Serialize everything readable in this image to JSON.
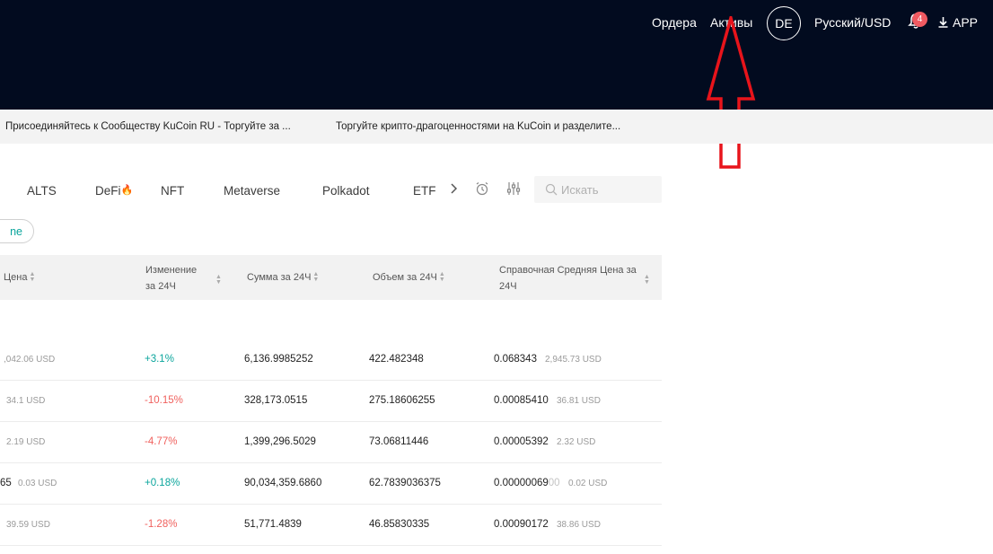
{
  "header": {
    "orders": "Ордера",
    "assets": "Активы",
    "avatar": "DE",
    "language": "Русский/USD",
    "notifications": "4",
    "app": "APP"
  },
  "ticker": [
    "Присоединяйтесь к Сообществу KuCoin RU - Торгуйте за ...",
    "Торгуйте крипто-драгоценностями на KuCoin и разделите..."
  ],
  "tabs": [
    "ALTS",
    "DeFi",
    "NFT",
    "Metaverse",
    "Polkadot",
    "ETF"
  ],
  "search": {
    "placeholder": "Искать"
  },
  "pill": "ne",
  "columns": {
    "price": "Цена",
    "change": "Изменение за 24Ч",
    "amount": "Сумма за 24Ч",
    "volume": "Объем за 24Ч",
    "avg_price": "Справочная Средняя Цена за 24Ч"
  },
  "rows": [
    {
      "price_sub": ",042.06 USD",
      "change": "+3.1%",
      "amount": "6,136.9985252",
      "volume": "422.482348",
      "avg": "0.068343",
      "avg_sub": "2,945.73 USD"
    },
    {
      "price_sub": "34.1 USD",
      "change": "-10.15%",
      "amount": "328,173.0515",
      "volume": "275.18606255",
      "avg": "0.00085410",
      "avg_sub": "36.81 USD"
    },
    {
      "price_sub": "2.19 USD",
      "change": "-4.77%",
      "amount": "1,399,296.5029",
      "volume": "73.06811446",
      "avg": "0.00005392",
      "avg_sub": "2.32 USD"
    },
    {
      "price_main": "65",
      "price_sub": "0.03 USD",
      "change": "+0.18%",
      "amount": "90,034,359.6860",
      "volume": "62.7839036375",
      "avg": "0.00000069",
      "avg_fade": "00",
      "avg_sub": "0.02 USD"
    },
    {
      "price_sub": "39.59 USD",
      "change": "-1.28%",
      "amount": "51,771.4839",
      "volume": "46.85830335",
      "avg": "0.00090172",
      "avg_sub": "38.86 USD"
    }
  ],
  "colors": {
    "header_bg": "#020b1f",
    "positive": "#0aa59c",
    "negative": "#f0615e",
    "annotation": "#e8141b"
  }
}
